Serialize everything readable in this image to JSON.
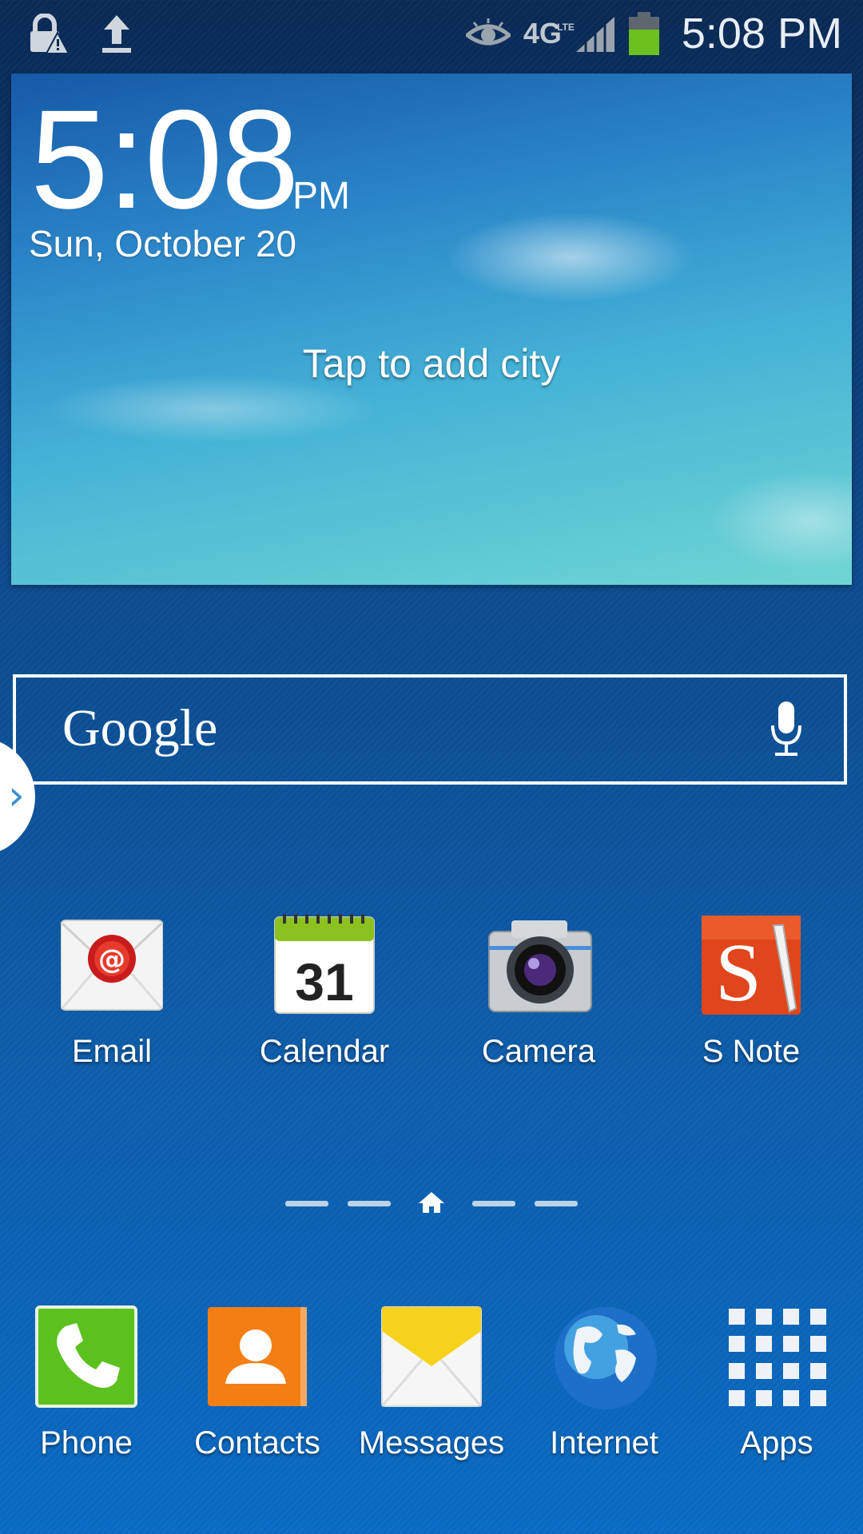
{
  "status_bar": {
    "time": "5:08 PM",
    "network": "4G",
    "network_sub": "LTE",
    "icons": [
      "lock-warning-icon",
      "upload-icon",
      "eye-icon",
      "4g-lte-icon",
      "signal-icon",
      "battery-icon"
    ]
  },
  "widget": {
    "clock": "5:08",
    "ampm": "PM",
    "date": "Sun, October 20",
    "weather_prompt": "Tap to add city"
  },
  "search": {
    "logo": "Google"
  },
  "apps": [
    {
      "label": "Email",
      "icon": "email-icon"
    },
    {
      "label": "Calendar",
      "icon": "calendar-icon",
      "icon_text": "31"
    },
    {
      "label": "Camera",
      "icon": "camera-icon"
    },
    {
      "label": "S Note",
      "icon": "s-note-icon",
      "icon_text": "S"
    }
  ],
  "dock": [
    {
      "label": "Phone",
      "icon": "phone-icon"
    },
    {
      "label": "Contacts",
      "icon": "contacts-icon"
    },
    {
      "label": "Messages",
      "icon": "messages-icon"
    },
    {
      "label": "Internet",
      "icon": "globe-icon"
    },
    {
      "label": "Apps",
      "icon": "apps-grid-icon"
    }
  ],
  "colors": {
    "phone_green": "#5cc11e",
    "contacts_orange": "#f37f12",
    "snote_red": "#e0451b",
    "calendar_green": "#8cc21f"
  }
}
